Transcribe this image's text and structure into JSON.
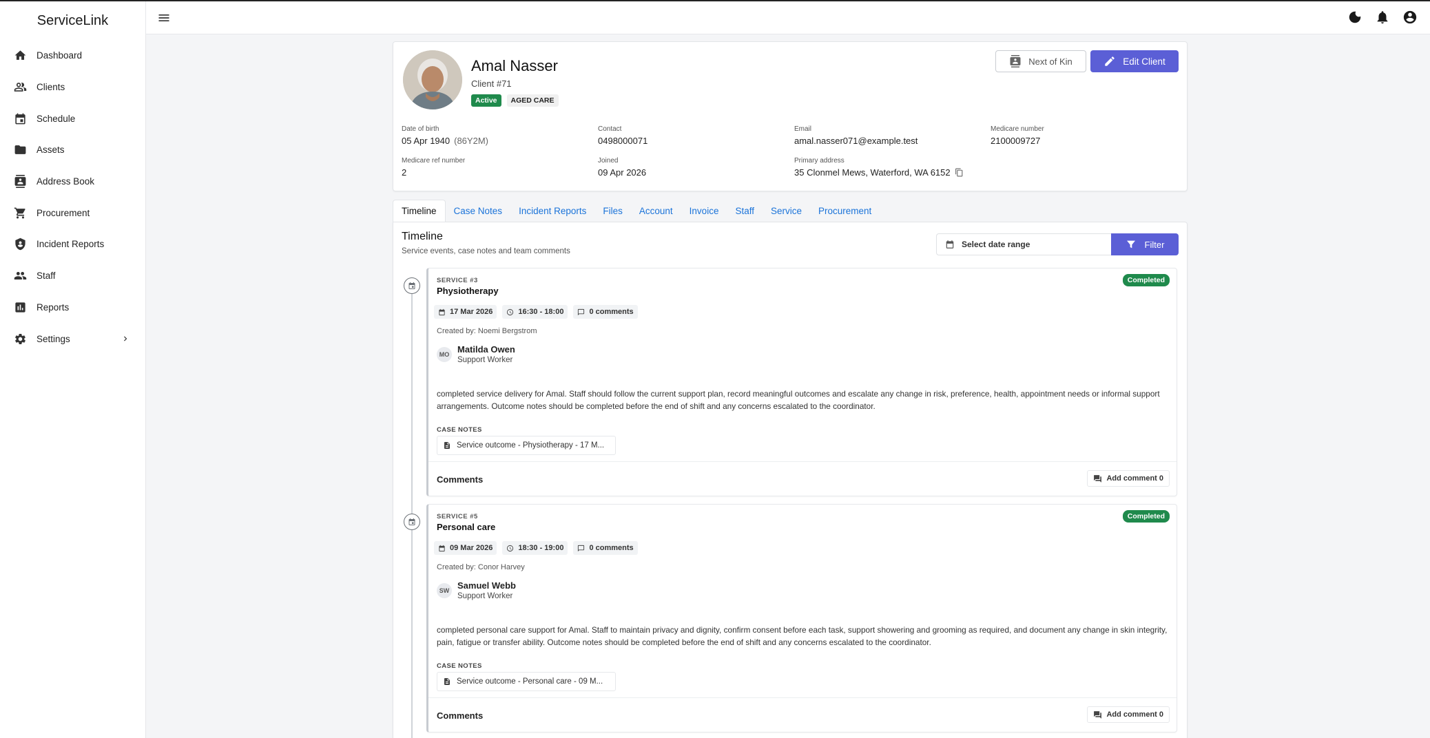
{
  "app": {
    "brand": "ServiceLink"
  },
  "sidebar": {
    "items": [
      {
        "label": "Dashboard",
        "icon": "home-icon"
      },
      {
        "label": "Clients",
        "icon": "clients-icon"
      },
      {
        "label": "Schedule",
        "icon": "calendar-icon"
      },
      {
        "label": "Assets",
        "icon": "folder-icon"
      },
      {
        "label": "Address Book",
        "icon": "contacts-icon"
      },
      {
        "label": "Procurement",
        "icon": "cart-icon"
      },
      {
        "label": "Incident Reports",
        "icon": "shield-icon"
      },
      {
        "label": "Staff",
        "icon": "people-icon"
      },
      {
        "label": "Reports",
        "icon": "bar-chart-icon"
      },
      {
        "label": "Settings",
        "icon": "gear-icon"
      }
    ]
  },
  "client": {
    "name": "Amal Nasser",
    "number": "Client #71",
    "status": "Active",
    "program": "AGED CARE",
    "next_of_kin_label": "Next of Kin",
    "edit_label": "Edit Client",
    "details": {
      "dob_label": "Date of birth",
      "dob_value": "05 Apr 1940",
      "dob_age": "(86Y2M)",
      "contact_label": "Contact",
      "contact_value": "0498000071",
      "email_label": "Email",
      "email_value": "amal.nasser071@example.test",
      "medicare_label": "Medicare number",
      "medicare_value": "2100009727",
      "medicare_ref_label": "Medicare ref number",
      "medicare_ref_value": "2",
      "joined_label": "Joined",
      "joined_value": "09 Apr 2026",
      "address_label": "Primary address",
      "address_value": "35 Clonmel Mews, Waterford, WA 6152"
    }
  },
  "tabs": [
    "Timeline",
    "Case Notes",
    "Incident Reports",
    "Files",
    "Account",
    "Invoice",
    "Staff",
    "Service",
    "Procurement"
  ],
  "timeline": {
    "title": "Timeline",
    "subtitle": "Service events, case notes and team comments",
    "date_range_placeholder": "Select date range",
    "filter_label": "Filter",
    "events": [
      {
        "kicker": "SERVICE #3",
        "title": "Physiotherapy",
        "status": "Completed",
        "date": "17 Mar 2026",
        "time": "16:30 - 18:00",
        "comments_count": "0 comments",
        "created_by": "Created by: Noemi Bergstrom",
        "staff_initials": "MO",
        "staff_name": "Matilda Owen",
        "staff_role": "Support Worker",
        "description": "completed service delivery for Amal. Staff should follow the current support plan, record meaningful outcomes and escalate any change in risk, preference, health, appointment needs or informal support arrangements. Outcome notes should be completed before the end of shift and any concerns escalated to the coordinator.",
        "case_notes_label": "CASE NOTES",
        "case_note": "Service outcome - Physiotherapy - 17 M...",
        "comments_label": "Comments",
        "add_comment_label": "Add comment 0"
      },
      {
        "kicker": "SERVICE #5",
        "title": "Personal care",
        "status": "Completed",
        "date": "09 Mar 2026",
        "time": "18:30 - 19:00",
        "comments_count": "0 comments",
        "created_by": "Created by: Conor Harvey",
        "staff_initials": "SW",
        "staff_name": "Samuel Webb",
        "staff_role": "Support Worker",
        "description": "completed personal care support for Amal. Staff to maintain privacy and dignity, confirm consent before each task, support showering and grooming as required, and document any change in skin integrity, pain, fatigue or transfer ability. Outcome notes should be completed before the end of shift and any concerns escalated to the coordinator.",
        "case_notes_label": "CASE NOTES",
        "case_note": "Service outcome - Personal care - 09 M...",
        "comments_label": "Comments",
        "add_comment_label": "Add comment 0"
      }
    ]
  }
}
